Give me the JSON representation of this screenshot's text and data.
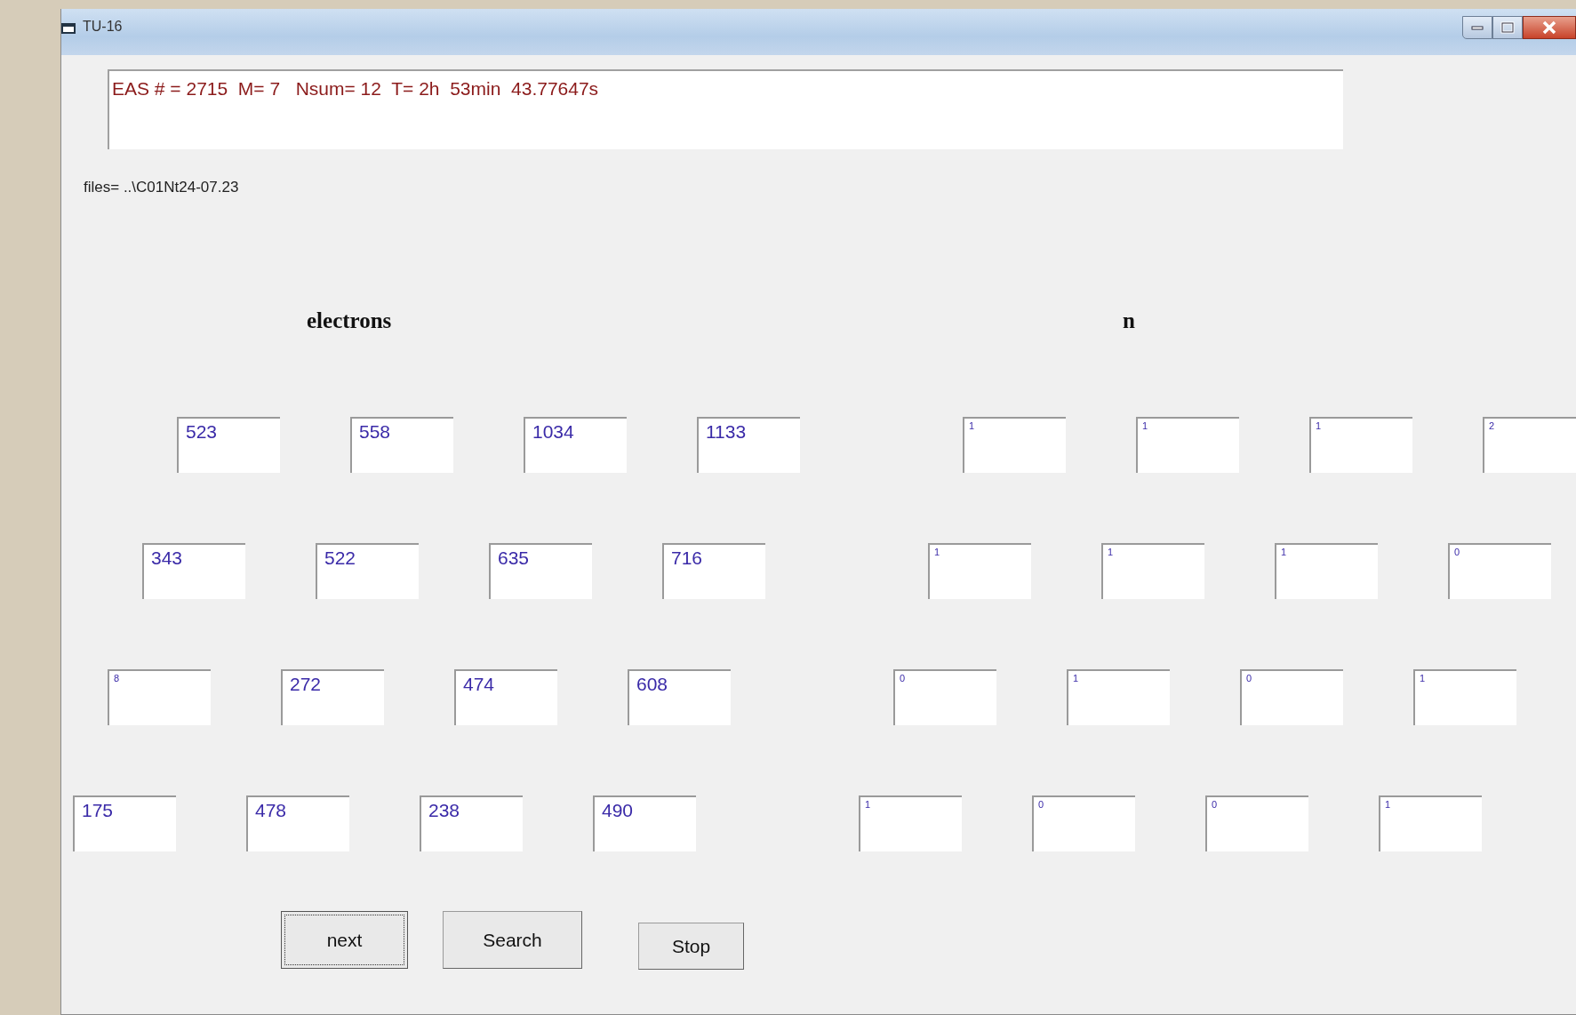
{
  "window": {
    "title": "TU-16"
  },
  "status": "EAS # = 2715  M= 7   Nsum= 12  T= 2h  53min  43.77647s",
  "files": "files= ..\\C01Nt24-07.23",
  "electrons": {
    "label": "electrons",
    "rows": [
      [
        {
          "value": "523",
          "kind": "large"
        },
        {
          "value": "558",
          "kind": "large"
        },
        {
          "value": "1034",
          "kind": "large"
        },
        {
          "value": "1133",
          "kind": "large"
        }
      ],
      [
        {
          "value": "343",
          "kind": "large"
        },
        {
          "value": "522",
          "kind": "large"
        },
        {
          "value": "635",
          "kind": "large"
        },
        {
          "value": "716",
          "kind": "large"
        }
      ],
      [
        {
          "value": "8",
          "kind": "small"
        },
        {
          "value": "272",
          "kind": "large"
        },
        {
          "value": "474",
          "kind": "large"
        },
        {
          "value": "608",
          "kind": "large"
        }
      ],
      [
        {
          "value": "175",
          "kind": "large"
        },
        {
          "value": "478",
          "kind": "large"
        },
        {
          "value": "238",
          "kind": "large"
        },
        {
          "value": "490",
          "kind": "large"
        }
      ]
    ]
  },
  "n": {
    "label": "n",
    "rows": [
      [
        {
          "value": "1",
          "kind": "small"
        },
        {
          "value": "1",
          "kind": "small"
        },
        {
          "value": "1",
          "kind": "small"
        },
        {
          "value": "2",
          "kind": "small"
        }
      ],
      [
        {
          "value": "1",
          "kind": "small"
        },
        {
          "value": "1",
          "kind": "small"
        },
        {
          "value": "1",
          "kind": "small"
        },
        {
          "value": "0",
          "kind": "small"
        }
      ],
      [
        {
          "value": "0",
          "kind": "small"
        },
        {
          "value": "1",
          "kind": "small"
        },
        {
          "value": "0",
          "kind": "small"
        },
        {
          "value": "1",
          "kind": "small"
        }
      ],
      [
        {
          "value": "1",
          "kind": "small"
        },
        {
          "value": "0",
          "kind": "small"
        },
        {
          "value": "0",
          "kind": "small"
        },
        {
          "value": "1",
          "kind": "small"
        }
      ]
    ]
  },
  "buttons": [
    {
      "label": "next",
      "focused": true
    },
    {
      "label": "Search",
      "focused": false
    },
    {
      "label": "Stop",
      "focused": false
    }
  ]
}
